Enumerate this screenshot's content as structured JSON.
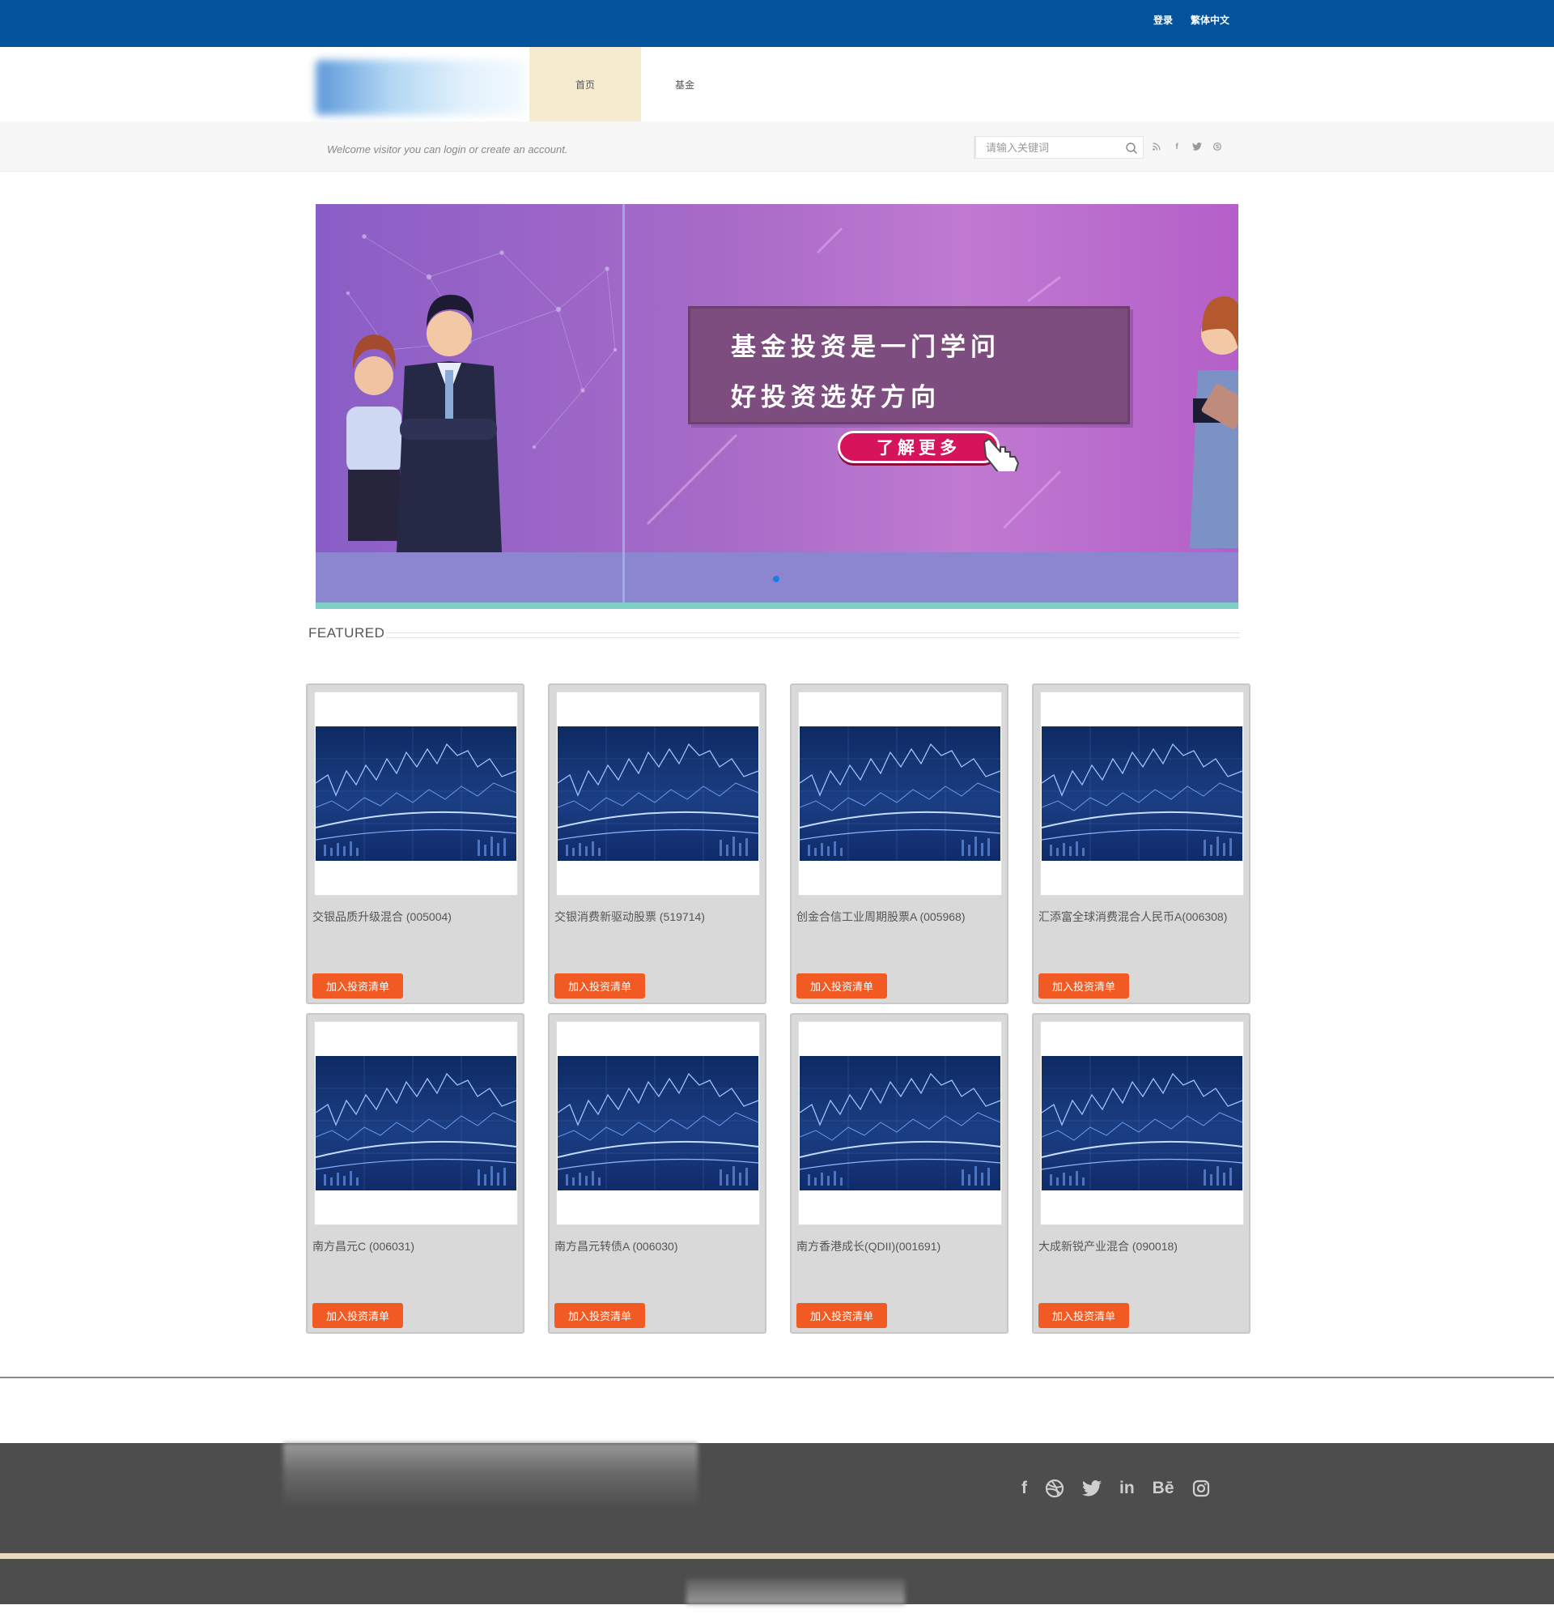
{
  "topbar": {
    "login": "登录",
    "language": "繁体中文"
  },
  "nav": {
    "home": "首页",
    "fund": "基金"
  },
  "welcome": "Welcome visitor you can login or create an account.",
  "search": {
    "placeholder": "请输入关键词"
  },
  "social_small": [
    "rss-icon",
    "facebook-icon",
    "twitter-icon",
    "skype-icon"
  ],
  "banner": {
    "line1": "基金投资是一门学问",
    "line2": "好投资选好方向",
    "cta": "了解更多"
  },
  "featured": {
    "title": "FEATURED"
  },
  "cards": [
    {
      "name": "交银品质升级混合 (005004)",
      "button": "加入投资清单"
    },
    {
      "name": "交银消费新驱动股票 (519714)",
      "button": "加入投资清单"
    },
    {
      "name": "创金合信工业周期股票A (005968)",
      "button": "加入投资清单"
    },
    {
      "name": "汇添富全球消费混合人民币A(006308)",
      "button": "加入投资清单"
    },
    {
      "name": "南方昌元C (006031)",
      "button": "加入投资清单"
    },
    {
      "name": "南方昌元转债A (006030)",
      "button": "加入投资清单"
    },
    {
      "name": "南方香港成长(QDII)(001691)",
      "button": "加入投资清单"
    },
    {
      "name": "大成新锐产业混合 (090018)",
      "button": "加入投资清单"
    }
  ],
  "footer": {
    "social": [
      "facebook-icon",
      "dribbble-icon",
      "twitter-icon",
      "linkedin-icon",
      "behance-icon",
      "instagram-icon"
    ]
  }
}
